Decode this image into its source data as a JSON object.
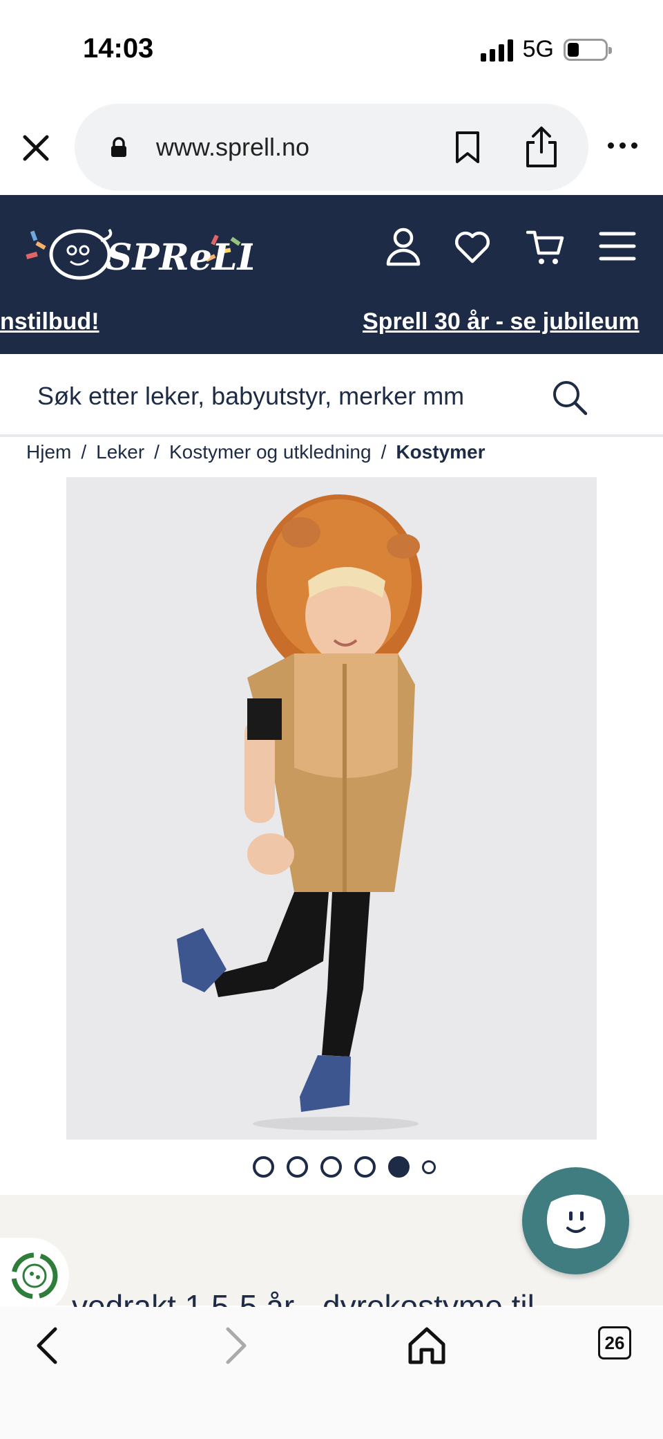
{
  "status_bar": {
    "time": "14:03",
    "network": "5G"
  },
  "browser": {
    "url": "www.sprell.no"
  },
  "site": {
    "announcements": [
      "nstilbud!",
      "Sprell 30 år - se jubileum"
    ],
    "search_placeholder": "Søk etter leker, babyutstyr, merker mm"
  },
  "breadcrumb": [
    {
      "label": "Hjem"
    },
    {
      "label": "Leker"
    },
    {
      "label": "Kostymer og utkledning"
    },
    {
      "label": "Kostymer"
    }
  ],
  "breadcrumb_sep": "/",
  "carousel": {
    "count": 6,
    "active_index": 4
  },
  "product": {
    "title_partial": "vedrakt 1,5-5 år - dyrekostyme til"
  },
  "tabs": {
    "count": "26"
  },
  "colors": {
    "header_bg": "#1d2b46",
    "accent_teal": "#3f7d80",
    "lower_bg": "#f4f3f0"
  }
}
